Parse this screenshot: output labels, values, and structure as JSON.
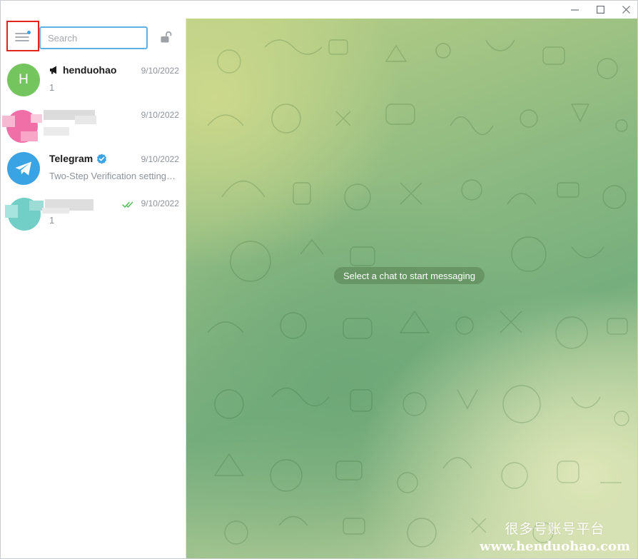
{
  "window": {
    "controls": [
      "minimize",
      "maximize",
      "close"
    ]
  },
  "sidebar": {
    "search": {
      "placeholder": "Search",
      "value": ""
    },
    "chats": [
      {
        "name": "henduohao",
        "date": "9/10/2022",
        "preview": "1",
        "avatar_letter": "H",
        "avatar_color": "#75c55f",
        "icon": "megaphone-icon"
      },
      {
        "name": "",
        "date": "9/10/2022",
        "preview": "",
        "blurred": true
      },
      {
        "name": "Telegram",
        "date": "9/10/2022",
        "preview": "Two-Step Verification settings…",
        "avatar_color": "#3aa3e3",
        "verified": true,
        "icon": "telegram-plane-icon"
      },
      {
        "name": "",
        "date": "9/10/2022",
        "preview": "1",
        "blurred": true,
        "read_icon": "double-check-icon"
      }
    ]
  },
  "main": {
    "empty_message": "Select a chat to start messaging"
  },
  "watermark": {
    "chinese": "很多号账号平台",
    "url": "www.henduohao.com"
  },
  "colors": {
    "accent": "#5fb0e5",
    "highlight_box": "#e3241c",
    "read_check": "#4fbf57"
  }
}
